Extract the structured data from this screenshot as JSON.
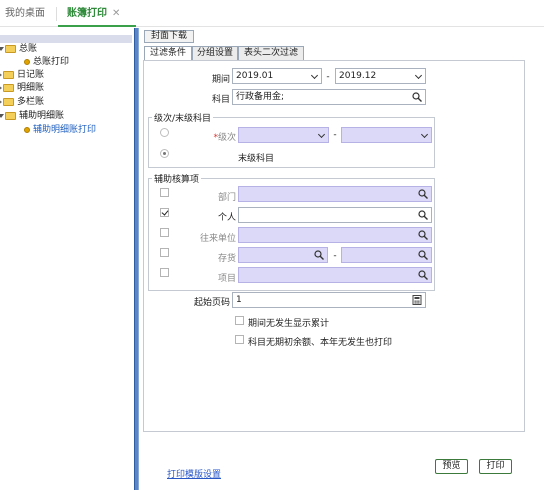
{
  "tabs": {
    "home": "我的桌面",
    "print": "账簿打印",
    "close": "✕"
  },
  "tree": {
    "ledger": "总账",
    "ledger_print": "总账打印",
    "journal": "日记账",
    "detail": "明细账",
    "multi": "多栏账",
    "aux_detail": "辅助明细账",
    "aux_detail_print": "辅助明细账打印"
  },
  "toolbar": {
    "cover_download": "封面下载"
  },
  "subtabs": {
    "filter": "过滤条件",
    "group": "分组设置",
    "header": "表头二次过滤"
  },
  "period": {
    "label": "期间",
    "from": "2019.01",
    "dash": "-",
    "to": "2019.12"
  },
  "subject": {
    "label": "科目",
    "value": "行政备用金;"
  },
  "level_group": {
    "title": "级次/末级科目",
    "level_star": "*",
    "level_label": "级次",
    "dash": "-",
    "last_label": "末级科目"
  },
  "aux_group": {
    "title": "辅助核算项",
    "dept": "部门",
    "person": "个人",
    "contact": "往来单位",
    "inventory": "存货",
    "dash": "-",
    "project": "项目"
  },
  "start_page": {
    "label": "起始页码",
    "value": "1"
  },
  "options": {
    "show_cumulative": "期间无发生显示累计",
    "print_no_balance": "科目无期初余额、本年无发生也打印"
  },
  "footer": {
    "template_link": "打印模版设置",
    "preview": "预览",
    "print": "打印"
  }
}
